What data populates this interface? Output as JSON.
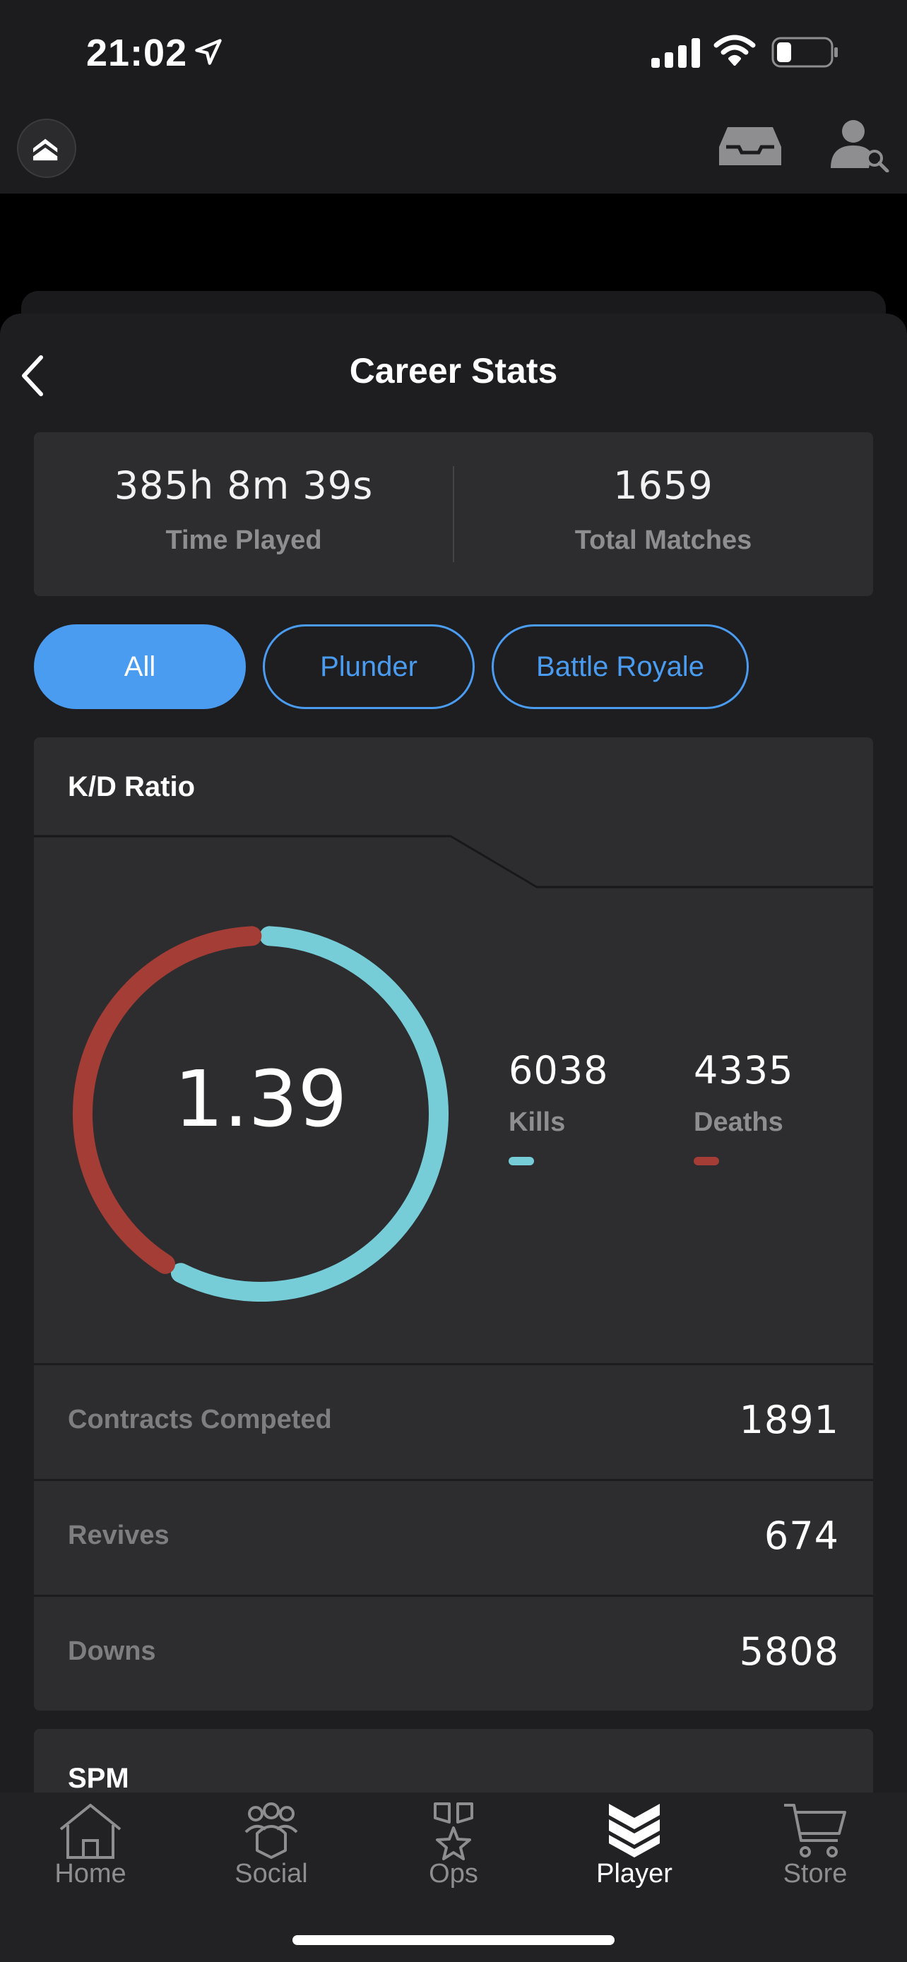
{
  "status_bar": {
    "time": "21:02"
  },
  "header": {
    "title": "Career Stats"
  },
  "summary": {
    "time_played_value": "385h 8m 39s",
    "time_played_label": "Time Played",
    "total_matches_value": "1659",
    "total_matches_label": "Total Matches"
  },
  "filters": [
    {
      "label": "All",
      "active": true
    },
    {
      "label": "Plunder",
      "active": false
    },
    {
      "label": "Battle Royale",
      "active": false
    }
  ],
  "kd": {
    "title": "K/D Ratio",
    "ratio": "1.39",
    "kills_value": "6038",
    "kills_label": "Kills",
    "deaths_value": "4335",
    "deaths_label": "Deaths",
    "kills_color": "#76cdd8",
    "deaths_color": "#a33d35",
    "kills_fraction": 0.582
  },
  "rows": [
    {
      "label": "Contracts Competed",
      "value": "1891"
    },
    {
      "label": "Revives",
      "value": "674"
    },
    {
      "label": "Downs",
      "value": "5808"
    }
  ],
  "spm": {
    "title": "SPM"
  },
  "tabbar": {
    "items": [
      {
        "label": "Home",
        "icon": "home-icon",
        "active": false
      },
      {
        "label": "Social",
        "icon": "social-icon",
        "active": false
      },
      {
        "label": "Ops",
        "icon": "ops-icon",
        "active": false
      },
      {
        "label": "Player",
        "icon": "player-icon",
        "active": true
      },
      {
        "label": "Store",
        "icon": "cart-icon",
        "active": false
      }
    ]
  },
  "colors": {
    "accent": "#4a9cf1",
    "card": "#2d2d2f",
    "background": "#1e1e20"
  }
}
